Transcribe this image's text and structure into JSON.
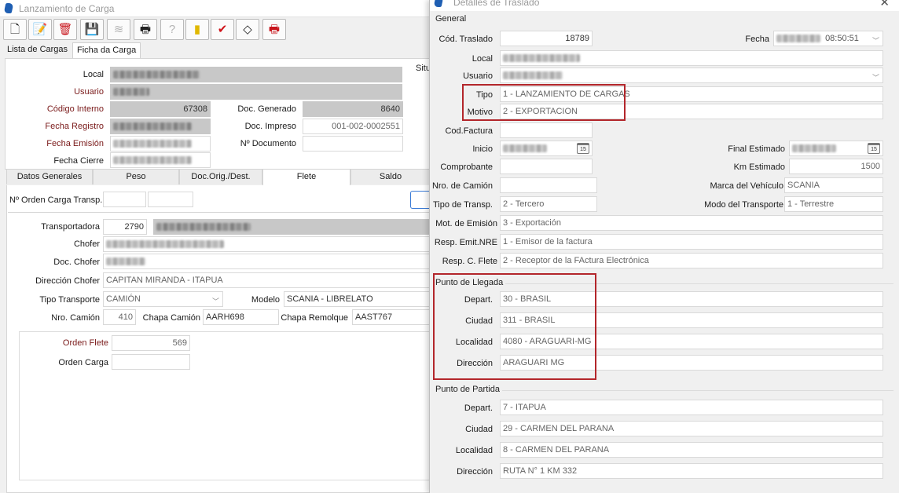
{
  "left": {
    "title": "Lanzamiento de Carga",
    "toolbar": [
      {
        "name": "new-document-icon",
        "glyph": "🗋"
      },
      {
        "name": "edit-document-icon",
        "glyph": "📝"
      },
      {
        "name": "delete-document-icon",
        "glyph": "🗑"
      },
      {
        "name": "save-icon",
        "glyph": "💾"
      },
      {
        "name": "signal-icon",
        "glyph": "≋"
      },
      {
        "name": "print-icon",
        "glyph": "🖶"
      },
      {
        "name": "help-icon",
        "glyph": "?"
      },
      {
        "name": "exit-icon",
        "glyph": "▮"
      },
      {
        "name": "confirm-icon",
        "glyph": "✔"
      },
      {
        "name": "eraser-icon",
        "glyph": "◇"
      },
      {
        "name": "print-red-icon",
        "glyph": "🖶"
      }
    ],
    "tabs": [
      "Lista de Cargas",
      "Ficha da Carga"
    ],
    "header": {
      "local_label": "Local",
      "usuario_label": "Usuario",
      "codigo_interno_label": "Código Interno",
      "codigo_interno": "67308",
      "doc_generado_label": "Doc. Generado",
      "doc_generado": "8640",
      "fecha_registro_label": "Fecha Registro",
      "doc_impreso_label": "Doc. Impreso",
      "doc_impreso": "001-002-0002551",
      "fecha_emision_label": "Fecha Emisión",
      "n_documento_label": "Nº Documento",
      "fecha_cierre_label": "Fecha Cierre",
      "situ_label": "Situ"
    },
    "subtabs": [
      "Datos Generales",
      "Peso",
      "Doc.Orig./Dest.",
      "Flete",
      "Saldo"
    ],
    "flete": {
      "orden_carga_transp_label": "Nº Orden Carga Transp.",
      "transportadora_label": "Transportadora",
      "transportadora_code": "2790",
      "chofer_label": "Chofer",
      "doc_chofer_label": "Doc. Chofer",
      "direccion_chofer_label": "Dirección Chofer",
      "direccion_chofer": "CAPITAN MIRANDA - ITAPUA",
      "tipo_transporte_label": "Tipo Transporte",
      "tipo_transporte": "CAMIÓN",
      "modelo_label": "Modelo",
      "modelo": "SCANIA - LIBRELATO",
      "nro_camion_label": "Nro. Camión",
      "nro_camion": "410",
      "chapa_camion_label": "Chapa Camión",
      "chapa_camion": "AARH698",
      "chapa_remolque_label": "Chapa Remolque",
      "chapa_remolque": "AAST767",
      "orden_flete_label": "Orden Flete",
      "orden_flete": "569",
      "orden_carga_label": "Orden Carga"
    }
  },
  "right": {
    "title": "Detalles de Traslado",
    "general_title": "General",
    "cod_traslado_label": "Cód. Traslado",
    "cod_traslado": "18789",
    "fecha_label": "Fecha",
    "fecha_time": "08:50:51",
    "local_label": "Local",
    "usuario_label": "Usuario",
    "tipo_label": "Tipo",
    "tipo": "1 - LANZAMIENTO DE CARGAS",
    "motivo_label": "Motivo",
    "motivo": "2 - EXPORTACION",
    "cod_factura_label": "Cod.Factura",
    "inicio_label": "Inicio",
    "final_estimado_label": "Final Estimado",
    "comprobante_label": "Comprobante",
    "km_estimado_label": "Km Estimado",
    "km_estimado": "1500",
    "nro_camion_label": "Nro. de Camión",
    "marca_vehiculo_label": "Marca del Vehículo",
    "marca_vehiculo": "SCANIA",
    "tipo_transp_label": "Tipo de Transp.",
    "tipo_transp": "2 - Tercero",
    "modo_transporte_label": "Modo del Transporte",
    "modo_transporte": "1 - Terrestre",
    "mot_emision_label": "Mot. de Emisión",
    "mot_emision": "3 - Exportación",
    "resp_emit_label": "Resp. Emit.NRE",
    "resp_emit": "1 - Emisor de la factura",
    "resp_flete_label": "Resp. C. Flete",
    "resp_flete": "2 - Receptor de la FActura Electrónica",
    "llegada": {
      "title": "Punto de Llegada",
      "depart_label": "Depart.",
      "depart": "30 - BRASIL",
      "ciudad_label": "Ciudad",
      "ciudad": "311 - BRASIL",
      "localidad_label": "Localidad",
      "localidad": "4080 - ARAGUARI-MG",
      "direccion_label": "Dirección",
      "direccion": "ARAGUARI MG"
    },
    "partida": {
      "title": "Punto de Partida",
      "depart_label": "Depart.",
      "depart": "7 - ITAPUA",
      "ciudad_label": "Ciudad",
      "ciudad": "29 - CARMEN DEL PARANA",
      "localidad_label": "Localidad",
      "localidad": "8 - CARMEN DEL PARANA",
      "direccion_label": "Dirección",
      "direccion": "RUTA N° 1 KM 332"
    }
  }
}
